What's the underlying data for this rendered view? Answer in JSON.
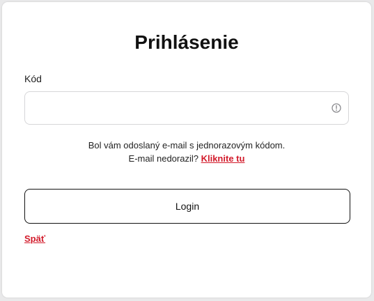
{
  "form": {
    "title": "Prihlásenie",
    "code_label": "Kód",
    "code_value": "",
    "code_placeholder": "",
    "hint_line1": "Bol vám odoslaný e-mail s jednorazovým kódom.",
    "hint_line2_prefix": "E-mail nedorazil? ",
    "resend_link": "Kliknite tu",
    "login_button": "Login",
    "back_link": "Späť"
  },
  "icons": {
    "code_field_status": "alert-circle-icon"
  },
  "colors": {
    "accent": "#d21a2a",
    "text": "#111111",
    "border": "#d6d6d8"
  }
}
